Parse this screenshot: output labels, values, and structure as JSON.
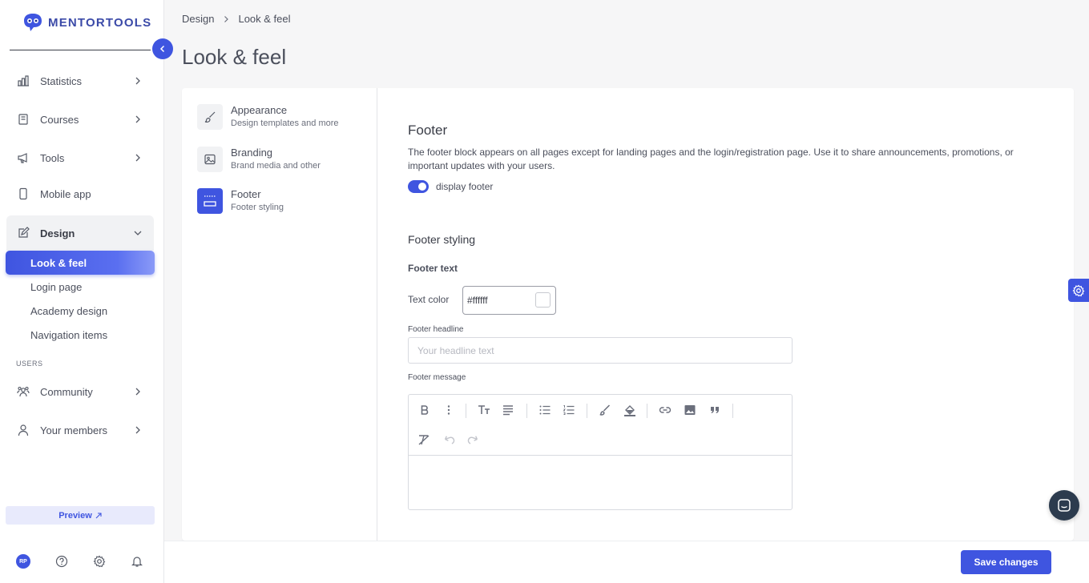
{
  "brand": {
    "name": "MENTORTOOLS",
    "accent": "#3f55e0"
  },
  "sidebar": {
    "items": [
      {
        "label": "Statistics",
        "icon": "bar-chart-icon"
      },
      {
        "label": "Courses",
        "icon": "book-icon"
      },
      {
        "label": "Tools",
        "icon": "megaphone-icon"
      },
      {
        "label": "Mobile app",
        "icon": "mobile-icon"
      },
      {
        "label": "Design",
        "icon": "pencil-square-icon"
      }
    ],
    "design_sub": [
      "Look & feel",
      "Login page",
      "Academy design",
      "Navigation items"
    ],
    "section_users": "USERS",
    "user_items": [
      {
        "label": "Community",
        "icon": "community-icon"
      },
      {
        "label": "Your members",
        "icon": "person-icon"
      }
    ],
    "preview": "Preview",
    "avatar_initials": "RP"
  },
  "breadcrumb": {
    "root": "Design",
    "current": "Look & feel"
  },
  "page_title": "Look & feel",
  "settings_menu": [
    {
      "title": "Appearance",
      "subtitle": "Design templates and more",
      "icon": "brush-icon"
    },
    {
      "title": "Branding",
      "subtitle": "Brand media and other",
      "icon": "image-icon"
    },
    {
      "title": "Footer",
      "subtitle": "Footer styling",
      "icon": "footer-icon"
    }
  ],
  "footer": {
    "title": "Footer",
    "description": "The footer block appears on all pages except for landing pages and the login/registration page. Use it to share announcements, promotions, or important updates with your users.",
    "toggle_label": "display footer",
    "toggle_on": true,
    "styling_title": "Footer styling",
    "text_heading": "Footer text",
    "text_color_label": "Text color",
    "text_color_value": "#ffffff",
    "headline_label": "Footer headline",
    "headline_placeholder": "Your headline text",
    "message_label": "Footer message"
  },
  "actions": {
    "save": "Save changes"
  }
}
